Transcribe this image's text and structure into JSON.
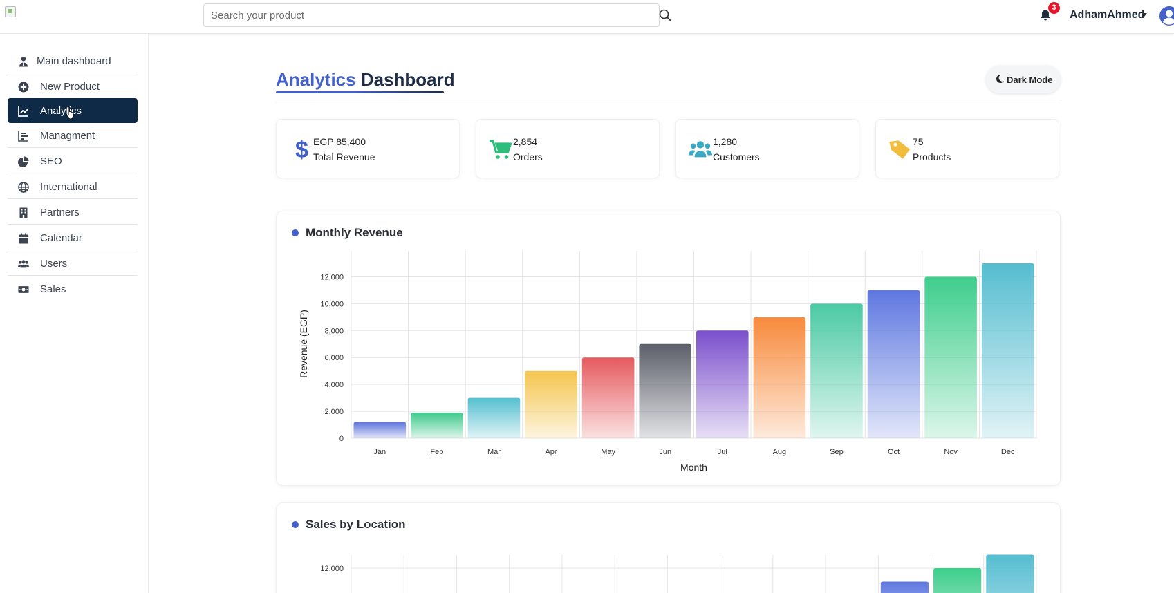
{
  "header": {
    "search_placeholder": "Search your product",
    "notification_count": "3",
    "user_name": "AdhamAhmed"
  },
  "sidebar": {
    "items": [
      {
        "label": "Main dashboard",
        "icon": "user-tie-icon",
        "active": false
      },
      {
        "label": "New Product",
        "icon": "plus-circle-icon",
        "active": false
      },
      {
        "label": "Analytics",
        "icon": "chart-line-icon",
        "active": true
      },
      {
        "label": "Managment",
        "icon": "chart-bar-icon",
        "active": false
      },
      {
        "label": "SEO",
        "icon": "chart-pie-icon",
        "active": false
      },
      {
        "label": "International",
        "icon": "globe-icon",
        "active": false
      },
      {
        "label": "Partners",
        "icon": "building-icon",
        "active": false
      },
      {
        "label": "Calendar",
        "icon": "calendar-icon",
        "active": false
      },
      {
        "label": "Users",
        "icon": "users-icon",
        "active": false
      },
      {
        "label": "Sales",
        "icon": "money-bill-icon",
        "active": false
      }
    ]
  },
  "main": {
    "title_accent": "Analytics",
    "title_rest": "Dashboard",
    "dark_mode_label": "Dark Mode",
    "stats": [
      {
        "value": "EGP 85,400",
        "label": "Total Revenue",
        "icon": "dollar-icon",
        "color": "#4361c8"
      },
      {
        "value": "2,854",
        "label": "Orders",
        "icon": "cart-icon",
        "color": "#2ebd7a"
      },
      {
        "value": "1,280",
        "label": "Customers",
        "icon": "users-icon",
        "color": "#3aa9c4"
      },
      {
        "value": "75",
        "label": "Products",
        "icon": "tag-icon",
        "color": "#f2bd3c"
      }
    ],
    "revenue_panel_title": "Monthly Revenue",
    "location_panel_title": "Sales by Location"
  },
  "colors": {
    "accent": "#4361c8",
    "nav_active_bg": "#0e2a47",
    "badge": "#e3172b"
  },
  "chart_data": [
    {
      "type": "bar",
      "title": "Monthly Revenue",
      "xlabel": "Month",
      "ylabel": "Revenue (EGP)",
      "ylim": [
        0,
        13000
      ],
      "yticks": [
        0,
        2000,
        4000,
        6000,
        8000,
        10000,
        12000
      ],
      "ytick_labels": [
        "0",
        "2,000",
        "4,000",
        "6,000",
        "8,000",
        "10,000",
        "12,000"
      ],
      "grid": true,
      "categories": [
        "Jan",
        "Feb",
        "Mar",
        "Apr",
        "May",
        "Jun",
        "Jul",
        "Aug",
        "Sep",
        "Oct",
        "Nov",
        "Dec"
      ],
      "values": [
        1200,
        1900,
        3000,
        5000,
        6000,
        7000,
        8000,
        9000,
        10000,
        11000,
        12000,
        13000
      ],
      "colors": [
        "#5b73dc",
        "#3fc98c",
        "#55bfd0",
        "#f5c54e",
        "#e65a5e",
        "#5c5f6a",
        "#7b4fcc",
        "#f88a3c",
        "#4ccaa4",
        "#5f78e0",
        "#3ece8c",
        "#55bdd0"
      ]
    },
    {
      "type": "bar",
      "title": "Sales by Location",
      "ytick_labels": [
        "12,000"
      ],
      "yticks": [
        12000
      ],
      "grid": true,
      "values": [
        11000,
        12000,
        13000
      ],
      "colors": [
        "#5f78e0",
        "#3ece8c",
        "#55bdd0"
      ]
    }
  ]
}
